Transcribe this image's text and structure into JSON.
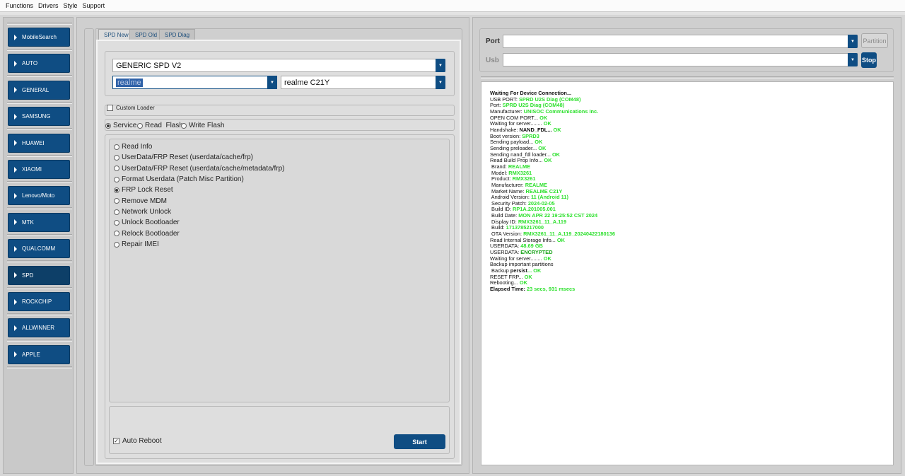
{
  "menu": [
    "Functions",
    "Drivers",
    "Style",
    "Support"
  ],
  "sidebar": {
    "items": [
      {
        "label": "MobileSearch",
        "active": false
      },
      {
        "label": "AUTO",
        "active": false
      },
      {
        "label": "GENERAL",
        "active": false
      },
      {
        "label": "SAMSUNG",
        "active": false
      },
      {
        "label": "HUAWEI",
        "active": false
      },
      {
        "label": "XIAOMI",
        "active": false
      },
      {
        "label": "Lenovo/Moto",
        "active": false
      },
      {
        "label": "MTK",
        "active": false
      },
      {
        "label": "QUALCOMM",
        "active": false
      },
      {
        "label": "SPD",
        "active": true
      },
      {
        "label": "ROCKCHIP",
        "active": false
      },
      {
        "label": "ALLWINNER",
        "active": false
      },
      {
        "label": "APPLE",
        "active": false
      }
    ]
  },
  "tabs": [
    {
      "label": "SPD New",
      "active": true
    },
    {
      "label": "SPD Old",
      "active": false
    },
    {
      "label": "SPD Diag",
      "active": false
    }
  ],
  "device": {
    "model_profile": "GENERIC SPD V2",
    "brand": "realme",
    "model": "realme C21Y"
  },
  "custom_loader": {
    "label": "Custom Loader",
    "checked": false
  },
  "mode": {
    "options": [
      "Service",
      "Read  Flash",
      "Write Flash"
    ],
    "selected": "Service"
  },
  "operations": {
    "selected": "FRP Lock Reset",
    "items": [
      "Read Info",
      "UserData/FRP Reset (userdata/cache/frp)",
      "UserData/FRP Reset (userdata/cache/metadata/frp)",
      "Format Userdata (Patch Misc Partition)",
      "FRP Lock Reset",
      "Remove MDM",
      "Network Unlock",
      "Unlock Bootloader",
      "Relock Bootloader",
      "Repair IMEI"
    ]
  },
  "auto_reboot": {
    "label": "Auto Reboot",
    "checked": true
  },
  "start_label": "Start",
  "connection": {
    "port_label": "Port",
    "usb_label": "Usb",
    "port_value": "",
    "usb_value": "",
    "partition_label": "Partition",
    "stop_label": "Stop"
  },
  "log": [
    {
      "label": "Waiting For Device Connection...",
      "value": "",
      "style": "bold"
    },
    {
      "label": "USB PORT: ",
      "value": "SPRD U2S Diag (COM48)",
      "style": "green"
    },
    {
      "label": "Port: ",
      "value": "SPRD U2S Diag (COM48)",
      "style": "green"
    },
    {
      "label": "Manufacturer: ",
      "value": "UNISOC Communications Inc.",
      "style": "green"
    },
    {
      "label": "OPEN COM PORT... ",
      "value": "OK",
      "style": "green"
    },
    {
      "label": "Waiting for server........ ",
      "value": "OK",
      "style": "green"
    },
    {
      "label": "Handshake: ",
      "value": "NAND_FDL... ",
      "value2": "OK",
      "style": "black-green"
    },
    {
      "label": "Boot version: ",
      "value": "SPRD3",
      "style": "green"
    },
    {
      "label": "Sending payload... ",
      "value": "OK",
      "style": "green"
    },
    {
      "label": "Sending preloader... ",
      "value": "OK",
      "style": "green"
    },
    {
      "label": "Sending nand_fdl loader... ",
      "value": "OK",
      "style": "green"
    },
    {
      "label": "Read Build Prop Info... ",
      "value": "OK",
      "style": "green"
    },
    {
      "label": " Brand: ",
      "value": "REALME",
      "style": "green"
    },
    {
      "label": " Model: ",
      "value": "RMX3261",
      "style": "green"
    },
    {
      "label": " Product: ",
      "value": "RMX3261",
      "style": "green"
    },
    {
      "label": " Manufacturer: ",
      "value": "REALME",
      "style": "green"
    },
    {
      "label": " Market Name: ",
      "value": "REALME C21Y",
      "style": "green"
    },
    {
      "label": " Android Version: ",
      "value": "11 (Android 11)",
      "style": "green"
    },
    {
      "label": " Security Patch: ",
      "value": "2024-02-05",
      "style": "green"
    },
    {
      "label": " Build ID: ",
      "value": "RP1A.201005.001",
      "style": "green"
    },
    {
      "label": " Build Date: ",
      "value": "MON APR 22 19:25:52 CST 2024",
      "style": "green"
    },
    {
      "label": " Display ID: ",
      "value": "RMX3261_11_A.119",
      "style": "green"
    },
    {
      "label": " Build: ",
      "value": "1713785217000",
      "style": "green"
    },
    {
      "label": " OTA Version: ",
      "value": "RMX3261_11_A.119_20240422180136",
      "style": "green"
    },
    {
      "label": "Read Internal Storage Info... ",
      "value": "OK",
      "style": "green"
    },
    {
      "label": "USERDATA: ",
      "value": "48.69 GB",
      "style": "green"
    },
    {
      "label": "USERDATA: ",
      "value": "ENCRYPTED",
      "style": "darkgreen"
    },
    {
      "label": "Waiting for server........ ",
      "value": "OK",
      "style": "green"
    },
    {
      "label": "Backup important partitions",
      "value": "",
      "style": "plain"
    },
    {
      "label": " Backup ",
      "value": "persist",
      "value2": "... OK",
      "style": "black-green"
    },
    {
      "label": "RESET FRP... ",
      "value": "OK",
      "style": "green"
    },
    {
      "label": "Rebooting... ",
      "value": "OK",
      "style": "green"
    },
    {
      "label": "Elapsed Time: ",
      "value": "23 secs, 931 msecs",
      "style": "bold-green"
    }
  ]
}
